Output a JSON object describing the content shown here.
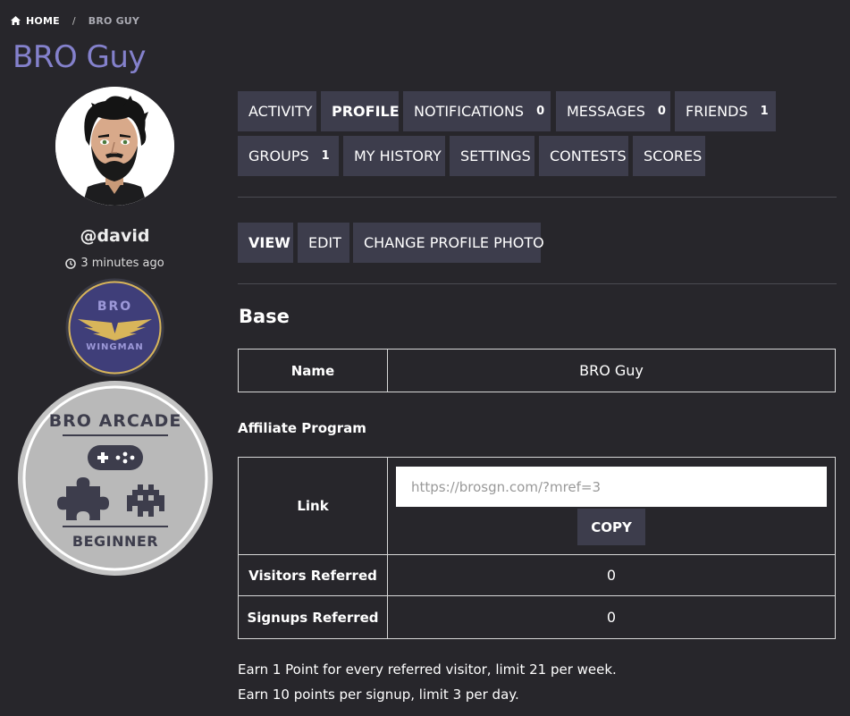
{
  "breadcrumb": {
    "home": "HOME",
    "separator": "/",
    "current": "BRO GUY"
  },
  "page_title": "BRO Guy",
  "profile": {
    "username": "@david",
    "last_active": "3 minutes ago",
    "badge1": {
      "line1": "BRO",
      "line2": "WINGMAN"
    },
    "badge2": {
      "line1": "BRO ARCADE",
      "line2": "BEGINNER"
    }
  },
  "tabs": [
    {
      "label": "ACTIVITY",
      "count": ""
    },
    {
      "label": "PROFILE",
      "count": ""
    },
    {
      "label": "NOTIFICATIONS",
      "count": "0"
    },
    {
      "label": "MESSAGES",
      "count": "0"
    },
    {
      "label": "FRIENDS",
      "count": "1"
    },
    {
      "label": "GROUPS",
      "count": "1"
    },
    {
      "label": "MY HISTORY",
      "count": ""
    },
    {
      "label": "SETTINGS",
      "count": ""
    },
    {
      "label": "CONTESTS",
      "count": ""
    },
    {
      "label": "SCORES",
      "count": ""
    }
  ],
  "subtabs": [
    {
      "label": "VIEW"
    },
    {
      "label": "EDIT"
    },
    {
      "label": "CHANGE PROFILE PHOTO"
    }
  ],
  "base": {
    "title": "Base",
    "name_label": "Name",
    "name_value": "BRO Guy"
  },
  "affiliate": {
    "title": "Affiliate Program",
    "link_label": "Link",
    "link_placeholder": "https://brosgn.com/?mref=3",
    "copy_label": "COPY",
    "visitors_label": "Visitors Referred",
    "visitors_value": "0",
    "signups_label": "Signups Referred",
    "signups_value": "0",
    "note1": "Earn 1 Point for every referred visitor, limit 21 per week.",
    "note2": "Earn 10 points per signup, limit 3 per day."
  },
  "colors": {
    "background": "#27262b",
    "button": "#3d3d4c",
    "title_accent": "#8481cc",
    "badge_gold": "#d8b55a"
  }
}
